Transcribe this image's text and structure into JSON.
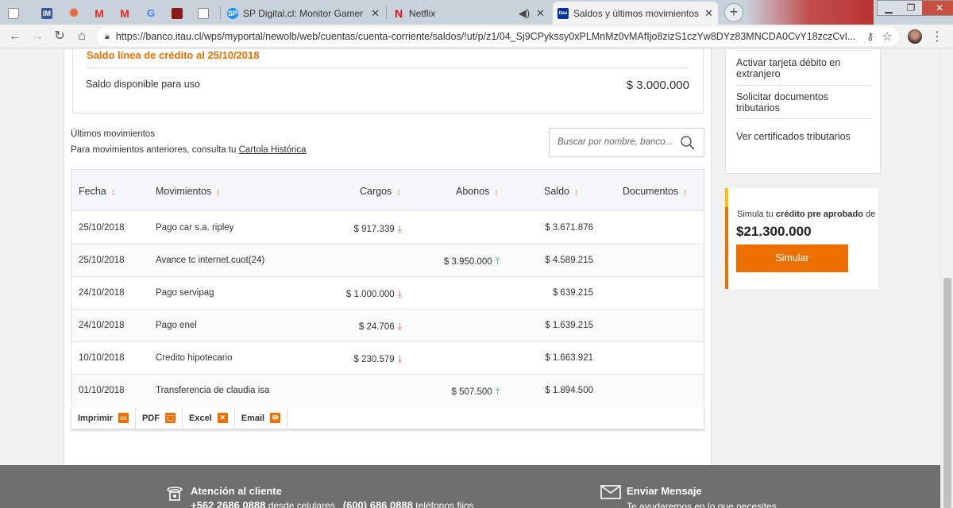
{
  "browser": {
    "tabs": [
      {
        "label": "",
        "favicon": "page-icon",
        "color": "#888888"
      },
      {
        "label": "",
        "favicon": "im-icon",
        "color": "#3b5998"
      },
      {
        "label": "",
        "favicon": "gear-icon",
        "color": "#e8663c"
      },
      {
        "label": "",
        "favicon": "gmail-icon",
        "color": "#d93025"
      },
      {
        "label": "",
        "favicon": "gmail-icon",
        "color": "#d93025"
      },
      {
        "label": "",
        "favicon": "google-icon",
        "color": "#4285f4"
      },
      {
        "label": "",
        "favicon": "extension-icon",
        "color": "#8b1a1a"
      },
      {
        "label": "",
        "favicon": "document-icon",
        "color": "#888888"
      },
      {
        "label": "SP Digital.cl: Monitor Gamer Curv",
        "favicon": "sp-icon",
        "color": "#1e90ff"
      },
      {
        "label": "Netflix",
        "favicon": "netflix-icon",
        "color": "#e50914"
      },
      {
        "label": "Saldos y últimos movimientos",
        "favicon": "itau-icon",
        "color": "#003399",
        "favicon_text": "itau"
      }
    ],
    "url": "https://banco.itau.cl/wps/myportal/newolb/web/cuentas/cuenta-corriente/saldos/!ut/p/z1/04_Sj9CPykssy0xPLMnMz0vMAfIjo8zizS1czYw8DYz83MNCDA0CvY18zczCvI..."
  },
  "credit": {
    "title": "Saldo línea de crédito al 25/10/2018",
    "label": "Saldo disponible para uso",
    "amount": "$ 3.000.000"
  },
  "movements": {
    "title": "Últimos movimientos",
    "subtitle_prefix": "Para movimientos anteriores, consulta tu ",
    "subtitle_link": "Cartola Histórica",
    "search_placeholder": "Buscar por nombre, banco...",
    "columns": [
      "Fecha",
      "Movimientos",
      "Cargos",
      "Abonos",
      "Saldo",
      "Documentos"
    ],
    "rows": [
      {
        "fecha": "25/10/2018",
        "movimiento": "Pago car s.a. ripley",
        "cargo": "$ 917.339",
        "abono": "",
        "saldo": "$ 3.671.876"
      },
      {
        "fecha": "25/10/2018",
        "movimiento": "Avance tc internet.cuot(24)",
        "cargo": "",
        "abono": "$ 3.950.000",
        "saldo": "$ 4.589.215"
      },
      {
        "fecha": "24/10/2018",
        "movimiento": "Pago servipag",
        "cargo": "$ 1.000.000",
        "abono": "",
        "saldo": "$ 639.215"
      },
      {
        "fecha": "24/10/2018",
        "movimiento": "Pago enel",
        "cargo": "$ 24.706",
        "abono": "",
        "saldo": "$ 1.639.215"
      },
      {
        "fecha": "10/10/2018",
        "movimiento": "Credito hipotecario",
        "cargo": "$ 230.579",
        "abono": "",
        "saldo": "$ 1.663.921"
      },
      {
        "fecha": "01/10/2018",
        "movimiento": "Transferencia de claudia isa",
        "cargo": "",
        "abono": "$ 507.500",
        "saldo": "$ 1.894.500"
      }
    ],
    "export": [
      "Imprimir",
      "PDF",
      "Excel",
      "Email"
    ]
  },
  "sidebar": {
    "links": [
      "Activar tarjeta débito en extranjero",
      "Solicitar documentos tributarios",
      "Ver certificados tributarios"
    ]
  },
  "promo": {
    "text_prefix": "Simula tu ",
    "text_bold": "crédito pre aprobado",
    "text_suffix": " de",
    "amount": "$21.300.000",
    "button": "Simular"
  },
  "footer": {
    "support_title": "Atención al cliente",
    "phone_mobile": "+562 2686 0888",
    "phone_mobile_suffix": " desde celulares",
    "phone_fixed": "(600) 686 0888",
    "phone_fixed_suffix": " teléfonos fijos",
    "message_title": "Enviar Mensaje",
    "message_sub": "Te ayudaremos en lo que necesites"
  },
  "colors": {
    "accent": "#ec7000",
    "down": "#e8663c",
    "up": "#3cb371"
  }
}
